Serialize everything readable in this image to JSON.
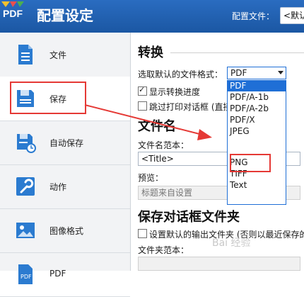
{
  "window": {
    "logo_text": "PDF",
    "title": "配置设定",
    "profile_label": "配置文件：",
    "profile_value": "<默认"
  },
  "sidebar": {
    "items": [
      {
        "label": "文件",
        "icon": "document-icon"
      },
      {
        "label": "保存",
        "icon": "save-icon"
      },
      {
        "label": "自动保存",
        "icon": "auto-save-icon"
      },
      {
        "label": "动作",
        "icon": "wrench-icon"
      },
      {
        "label": "图像格式",
        "icon": "image-icon"
      },
      {
        "label": "PDF",
        "icon": "pdf-icon"
      }
    ],
    "active_index": 1
  },
  "convert": {
    "title": "转换",
    "format_label": "选取默认的文件格式：",
    "format_selected": "PDF",
    "options": [
      "PDF",
      "PDF/A-1b",
      "PDF/A-2b",
      "PDF/X",
      "JPEG",
      "PNG",
      "TIFF",
      "Text"
    ],
    "show_progress_label": "显示转换进度",
    "show_progress_checked": true,
    "skip_print_label": "跳过打印对话框 (直接",
    "skip_print_checked": false
  },
  "filename": {
    "title": "文件名",
    "pattern_label": "文件名范本：",
    "pattern_value": "<Title>",
    "preview_label": "预览：",
    "preview_value": "标题来自设置"
  },
  "save_dialog": {
    "title": "保存对话框文件夹",
    "default_folder_label": "设置默认的输出文件夹 (否则以最近保存的",
    "default_folder_checked": false,
    "folder_pattern_label": "文件夹范本："
  },
  "colors": {
    "titlebar": "#1e5ca8",
    "annotation": "#e53935",
    "selection": "#1f6fd6"
  },
  "watermark": "Bai 经验"
}
